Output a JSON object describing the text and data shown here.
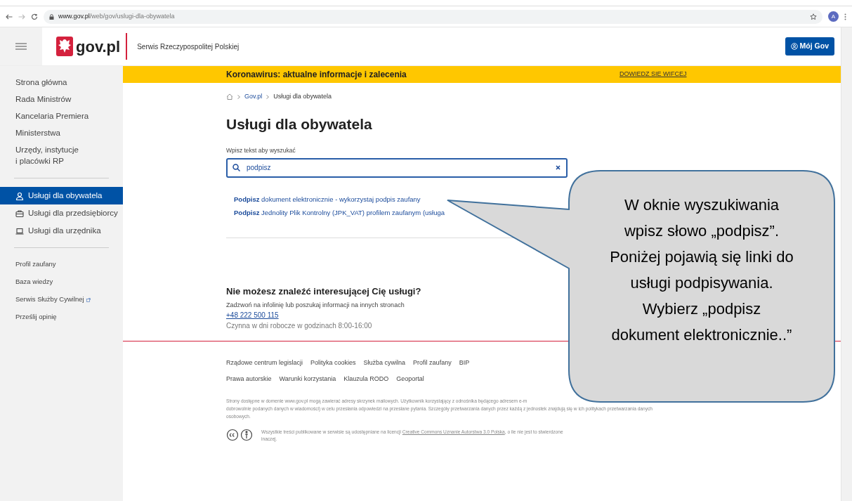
{
  "browser": {
    "url_host": "www.gov.pl",
    "url_path": "/web/gov/uslugi-dla-obywatela",
    "avatar": "A"
  },
  "header": {
    "logo": "gov.pl",
    "subtitle": "Serwis Rzeczypospolitej Polskiej",
    "account_button": "Mój Gov"
  },
  "sidebar": {
    "sections": [
      [
        {
          "label": "Strona główna",
          "kind": "link",
          "selected": false
        },
        {
          "label": "Rada Ministrów",
          "kind": "link",
          "selected": false
        },
        {
          "label": "Kancelaria Premiera",
          "kind": "link",
          "selected": false
        },
        {
          "label": "Ministerstwa",
          "kind": "link",
          "selected": false
        },
        {
          "label": "Urzędy, instytucje\ni placówki RP",
          "kind": "link",
          "selected": false
        }
      ],
      [
        {
          "label": "Usługi dla obywatela",
          "kind": "service",
          "selected": true
        },
        {
          "label": "Usługi dla przedsiębiorcy",
          "kind": "service",
          "selected": false
        },
        {
          "label": "Usługi dla urzędnika",
          "kind": "service",
          "selected": false
        }
      ],
      [
        {
          "label": "Profil zaufany",
          "kind": "small",
          "selected": false
        },
        {
          "label": "Baza wiedzy",
          "kind": "small",
          "selected": false
        },
        {
          "label": "Serwis Służby Cywilnej",
          "kind": "external",
          "selected": false
        },
        {
          "label": "Prześlij opinię",
          "kind": "small",
          "selected": false
        }
      ]
    ]
  },
  "banner": {
    "text": "Koronawirus: aktualne informacje i zalecenia",
    "link": "DOWIEDZ SIE WIFCEJ"
  },
  "breadcrumb": [
    "Gov.pl",
    "Usługi dla obywatela"
  ],
  "page_title": "Usługi dla obywatela",
  "search": {
    "label": "Wpisz tekst aby wyszukać",
    "value": "podpisz"
  },
  "results": [
    {
      "text": "**Podpisz** dokument elektronicznie - wykorzystaj podpis zaufany"
    },
    {
      "text": "**Podpisz** Jednolity Plik Kontrolny (JPK_VAT) profilem zaufanym  (usługa"
    }
  ],
  "help": {
    "title": "Nie możesz znaleźć interesującej Cię usługi?",
    "text": "Zadzwoń na infolinię lub poszukaj informacji na innych stronach",
    "phone": "+48 222 500 115",
    "hours": "Czynna w dni robocze w godzinach 8:00-16:00"
  },
  "footer": {
    "links": [
      [
        "Rządowe centrum legislacji",
        "Polityka cookies",
        "Służba cywilna",
        "Profil zaufany",
        "BIP"
      ],
      [
        "Prawa autorskie",
        "Warunki korzystania",
        "Klauzula RODO",
        "Geoportal"
      ]
    ],
    "disclaimer": [
      "Strony dostępne w domenie www.gov.pl mogą zawierać adresy skrzynek mailowych. Użytkownik korzystający z odnośnika będącego adresem e-m",
      "dobrowolnie podanych danych w wiadomości) w celu przesłania odpowiedzi na przesłane pytania. Szczegóły przetwarzania danych przez każdą z jednostek znajdują się w ich politykach przetwarzania danych",
      "osobowych."
    ],
    "license": {
      "before": "Wszystkie treści publikowane w serwisie są udostępniane na licencji",
      "link": "Creative Commons Uznanie Autorstwa 3.0 Polska",
      "after": ", o ile nie jest to stwierdzone inaczej."
    }
  },
  "callout": {
    "text": "W oknie wyszukiwania wpisz słowo „podpisz”. Poniżej pojawią się linki do usługi podpisywania. Wybierz „podpisz dokument elektronicznie..”"
  }
}
